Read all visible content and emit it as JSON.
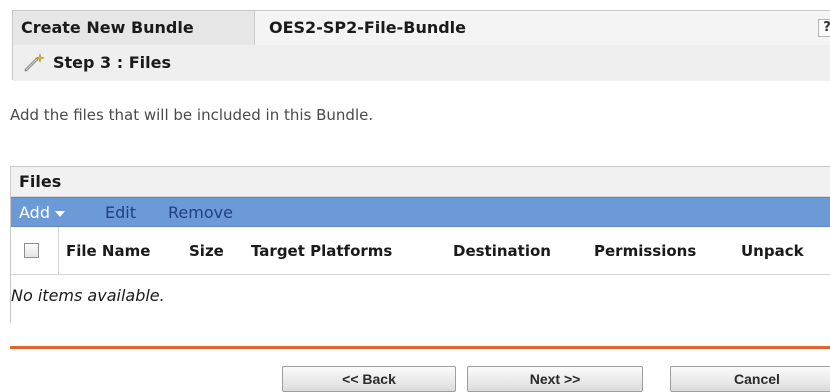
{
  "wizard": {
    "label": "Create New Bundle",
    "bundle_name": "OES2-SP2-File-Bundle",
    "help": "?",
    "step_title": "Step 3 : Files",
    "step_icon": "wand-icon"
  },
  "instructions": "Add the files that will be included in this Bundle.",
  "files_panel": {
    "title": "Files",
    "toolbar": {
      "add": "Add",
      "edit": "Edit",
      "remove": "Remove"
    },
    "columns": [
      "File Name",
      "Size",
      "Target Platforms",
      "Destination",
      "Permissions",
      "Unpack"
    ],
    "empty_message": "No items available."
  },
  "footer": {
    "back": "<< Back",
    "next": "Next >>",
    "cancel": "Cancel"
  },
  "colors": {
    "toolbar_bg": "#6c9ad6",
    "toolbar_link": "#1f3f86",
    "divider": "#e0652a"
  }
}
